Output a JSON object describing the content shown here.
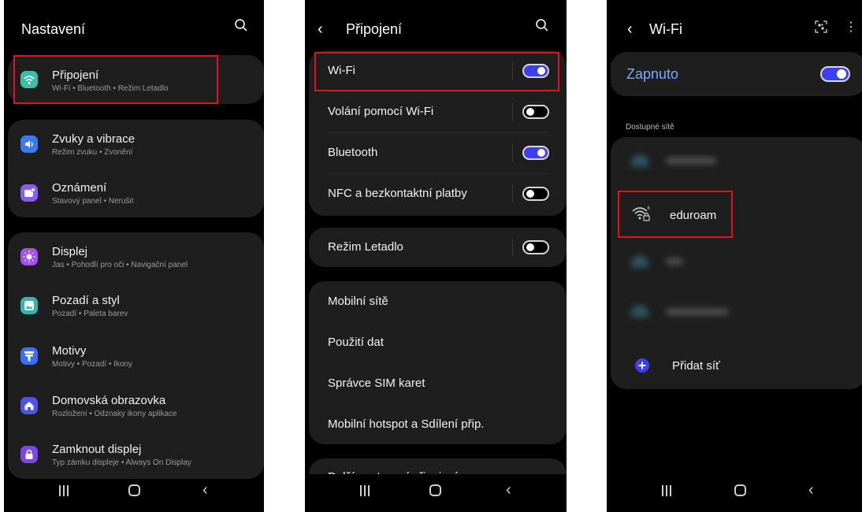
{
  "screen1": {
    "title": "Nastavení",
    "items": [
      {
        "title": "Připojení",
        "subtitle": "Wi-Fi  •  Bluetooth  •  Režim Letadlo",
        "icon": "wifi-icon",
        "color": "#3bbfa9"
      },
      {
        "title": "Zvuky a vibrace",
        "subtitle": "Režim zvuku  •  Zvonění",
        "icon": "speaker-icon",
        "color": "#3a7bf0"
      },
      {
        "title": "Oznámení",
        "subtitle": "Stavový panel  •  Nerušit",
        "icon": "notification-icon",
        "color": "#8b5cf0"
      },
      {
        "title": "Displej",
        "subtitle": "Jas  •  Pohodlí pro oči  •  Navigační panel",
        "icon": "sun-icon",
        "color": "#a34ff0"
      },
      {
        "title": "Pozadí a styl",
        "subtitle": "Pozadí  •  Paleta barev",
        "icon": "image-icon",
        "color": "#2fb7b0"
      },
      {
        "title": "Motivy",
        "subtitle": "Motivy  •  Pozadí  •  Ikony",
        "icon": "theme-brush-icon",
        "color": "#3a6ff0"
      },
      {
        "title": "Domovská obrazovka",
        "subtitle": "Rozložení  •  Odznaky ikony aplikace",
        "icon": "home-icon",
        "color": "#4d55e8"
      },
      {
        "title": "Zamknout displej",
        "subtitle": "Typ zámku displeje  •  Always On Display",
        "icon": "lock-icon",
        "color": "#7f45e8"
      }
    ]
  },
  "screen2": {
    "title": "Připojení",
    "toggles": [
      {
        "label": "Wi-Fi",
        "on": true
      },
      {
        "label": "Volání pomocí Wi-Fi",
        "on": false
      },
      {
        "label": "Bluetooth",
        "on": true
      },
      {
        "label": "NFC a bezkontaktní platby",
        "on": false
      }
    ],
    "airplane": {
      "label": "Režim Letadlo",
      "on": false
    },
    "items": [
      "Mobilní sítě",
      "Použití dat",
      "Správce SIM karet",
      "Mobilní hotspot a Sdílení přip."
    ],
    "more": "Další nastavení připojení"
  },
  "screen3": {
    "title": "Wi-Fi",
    "master": {
      "label": "Zapnuto",
      "on": true
    },
    "section": "Dostupné sítě",
    "network": "eduroam",
    "add": "Přidat síť"
  },
  "colors": {
    "accent": "#3c3ff0",
    "highlight": "#e0141c",
    "card": "#1e1e1e"
  }
}
